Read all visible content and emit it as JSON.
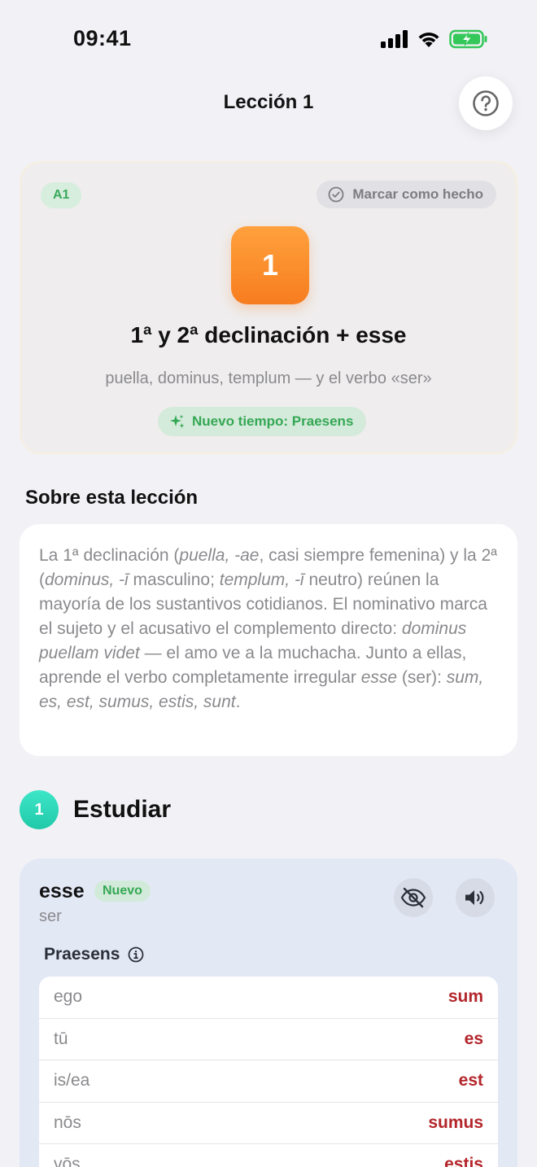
{
  "status_bar": {
    "time": "09:41"
  },
  "header": {
    "title": "Lección 1",
    "help_icon": "question-circle-icon"
  },
  "hero": {
    "level": "A1",
    "mark_done_label": "Marcar como hecho",
    "lesson_number": "1",
    "title": "1ª y 2ª declinación + esse",
    "subtitle": "puella, dominus, templum — y el verbo «ser»",
    "new_tense_label": "Nuevo tiempo: Praesens",
    "accent_color": "#f77d1f"
  },
  "about": {
    "heading": "Sobre esta lección",
    "parts": [
      "La 1ª declinación (",
      "puella, -ae",
      ", casi siempre femenina) y la 2ª (",
      "dominus, -ī",
      " masculino; ",
      "templum, -ī",
      " neutro) reúnen la mayoría de los sustantivos cotidianos. El nominativo marca el sujeto y el acusativo el complemento directo: ",
      "dominus puellam videt",
      " — el amo ve a la muchacha. Junto a ellas, aprende el verbo completamente irregular ",
      "esse",
      " (ser): ",
      "sum, es, est, sumus, estis, sunt",
      "."
    ]
  },
  "study": {
    "step_number": "1",
    "title": "Estudiar",
    "verb": {
      "word": "esse",
      "badge": "Nuevo",
      "meaning": "ser",
      "tense": "Praesens",
      "rows": [
        {
          "pronoun": "ego",
          "form": "sum"
        },
        {
          "pronoun": "tū",
          "form": "es"
        },
        {
          "pronoun": "is/ea",
          "form": "est"
        },
        {
          "pronoun": "nōs",
          "form": "sumus"
        },
        {
          "pronoun": "vōs",
          "form": "estis"
        }
      ]
    }
  }
}
